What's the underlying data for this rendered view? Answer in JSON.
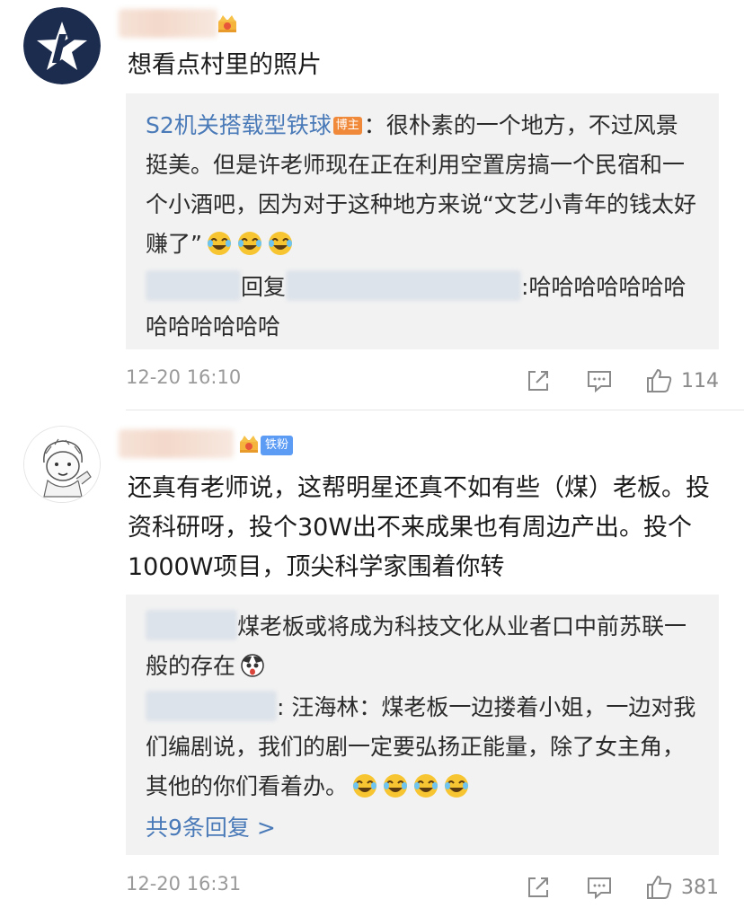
{
  "comments": [
    {
      "text": "想看点村里的照片",
      "badge": "",
      "replies": {
        "r1_author": "S2机关搭载型铁球",
        "r1_badge": "博主",
        "r1_text": "：很朴素的一个地方，不过风景挺美。但是许老师现在正在利用空置房搞一个民宿和一个小酒吧，因为对于这种地方来说“文艺小青年的钱太好赚了”",
        "r2_reply_word": "回复",
        "r2_text": ":哈哈哈哈哈哈哈哈哈哈哈哈哈"
      },
      "timestamp": "12-20 16:10",
      "likes": "114"
    },
    {
      "text": "还真有老师说，这帮明星还真不如有些（煤）老板。投资科研呀，投个30W出不来成果也有周边产出。投个1000W项目，顶尖科学家围着你转",
      "badge": "铁粉",
      "replies": {
        "r1_text": "煤老板或将成为科技文化从业者口中前苏联一般的存在",
        "r2_text": ": 汪海林：煤老板一边搂着小姐，一边对我们编剧说，我们的剧一定要弘扬正能量，除了女主角，其他的你们看着办。",
        "more": "共9条回复 >"
      },
      "timestamp": "12-20 16:31",
      "likes": "381"
    }
  ],
  "icons": {
    "share": "share-icon",
    "comment": "comment-icon",
    "like": "thumbs-up-icon",
    "crown": "crown-icon",
    "laugh": "laugh-cry-emoji",
    "shock": "shocked-emoji"
  },
  "colors": {
    "link": "#4a7ab8",
    "host_badge": "#f08a3a",
    "fan_badge": "#5d9cf5",
    "reply_bg": "#f2f2f2",
    "meta": "#9a9a9a"
  }
}
